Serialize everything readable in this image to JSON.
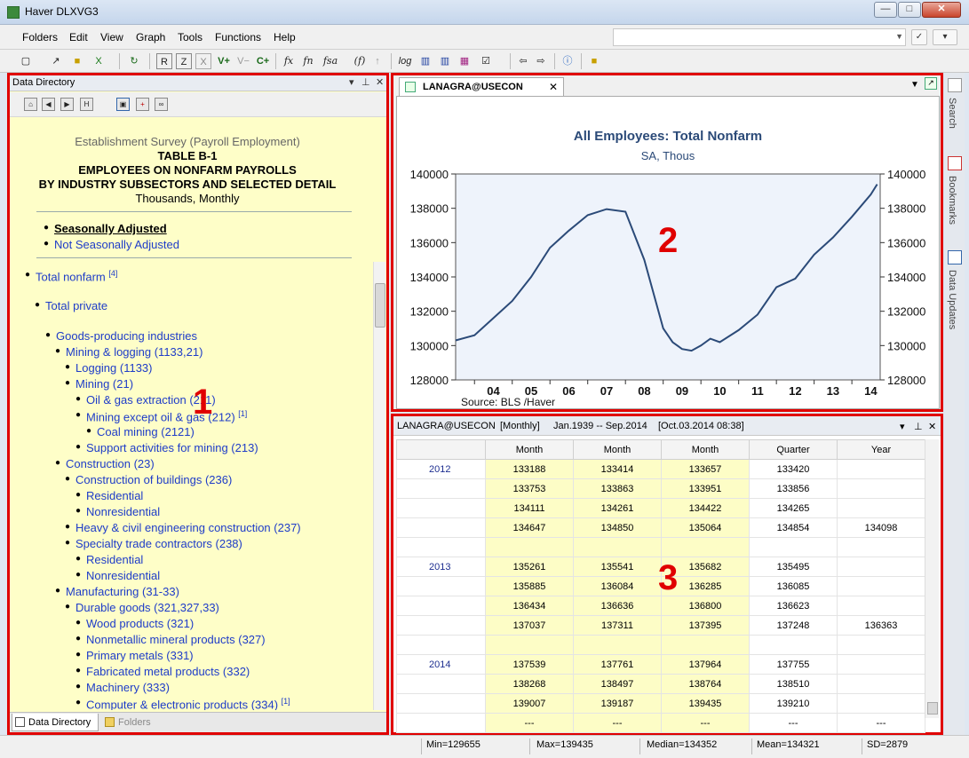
{
  "window": {
    "title": "Haver DLXVG3"
  },
  "menu": [
    "Folders",
    "Edit",
    "View",
    "Graph",
    "Tools",
    "Functions",
    "Help"
  ],
  "toolbar_labels": [
    "R",
    "Z",
    "X",
    "V+",
    "V−",
    "C+",
    "fx",
    "fn",
    "fsa",
    "(f)",
    "log"
  ],
  "data_directory": {
    "panel_title": "Data Directory",
    "heading": "Establishment Survey (Payroll Employment)",
    "table": "TABLE B-1",
    "line1": "EMPLOYEES ON NONFARM PAYROLLS",
    "line2": "BY INDUSTRY SUBSECTORS AND SELECTED DETAIL",
    "units": "Thousands, Monthly",
    "seasonal": "Seasonally Adjusted",
    "not_seasonal": "Not Seasonally Adjusted",
    "total_nonfarm": "Total nonfarm",
    "total_nonfarm_note": "[4]",
    "total_private": "Total private",
    "items": [
      {
        "text": "Goods-producing industries",
        "note": ""
      },
      {
        "text": "Mining & logging (1133,21)",
        "note": ""
      },
      {
        "text": "Logging (1133)",
        "note": ""
      },
      {
        "text": "Mining (21)",
        "note": ""
      },
      {
        "text": "Oil & gas extraction (211)",
        "note": ""
      },
      {
        "text": "Mining except oil & gas (212)",
        "note": "[1]"
      },
      {
        "text": "Coal mining (2121)",
        "note": ""
      },
      {
        "text": "Support activities for mining (213)",
        "note": ""
      },
      {
        "text": "Construction (23)",
        "note": ""
      },
      {
        "text": "Construction of buildings (236)",
        "note": ""
      },
      {
        "text": "Residential",
        "note": ""
      },
      {
        "text": "Nonresidential",
        "note": ""
      },
      {
        "text": "Heavy & civil engineering construction (237)",
        "note": ""
      },
      {
        "text": "Specialty trade contractors (238)",
        "note": ""
      },
      {
        "text": "Residential",
        "note": ""
      },
      {
        "text": "Nonresidential",
        "note": ""
      },
      {
        "text": "Manufacturing (31-33)",
        "note": ""
      },
      {
        "text": "Durable goods (321,327,33)",
        "note": ""
      },
      {
        "text": "Wood products (321)",
        "note": ""
      },
      {
        "text": "Nonmetallic mineral products (327)",
        "note": ""
      },
      {
        "text": "Primary metals (331)",
        "note": ""
      },
      {
        "text": "Fabricated metal products (332)",
        "note": ""
      },
      {
        "text": "Machinery (333)",
        "note": ""
      },
      {
        "text": "Computer & electronic products (334)",
        "note": "[1]"
      }
    ],
    "tab_directory": "Data Directory",
    "tab_folders": "Folders"
  },
  "graph": {
    "tab_label": "LANAGRA@USECON"
  },
  "table": {
    "header_series": "LANAGRA@USECON",
    "header_freq": "[Monthly]",
    "header_range": "Jan.1939 -- Sep.2014",
    "header_updated": "[Oct.03.2014 08:38]",
    "columns": [
      "",
      "Month",
      "Month",
      "Month",
      "Quarter",
      "Year"
    ],
    "rows": [
      [
        "2012",
        "133188",
        "133414",
        "133657",
        "133420",
        ""
      ],
      [
        "",
        "133753",
        "133863",
        "133951",
        "133856",
        ""
      ],
      [
        "",
        "134111",
        "134261",
        "134422",
        "134265",
        ""
      ],
      [
        "",
        "134647",
        "134850",
        "135064",
        "134854",
        "134098"
      ],
      [
        "",
        "",
        "",
        "",
        "",
        ""
      ],
      [
        "2013",
        "135261",
        "135541",
        "135682",
        "135495",
        ""
      ],
      [
        "",
        "135885",
        "136084",
        "136285",
        "136085",
        ""
      ],
      [
        "",
        "136434",
        "136636",
        "136800",
        "136623",
        ""
      ],
      [
        "",
        "137037",
        "137311",
        "137395",
        "137248",
        "136363"
      ],
      [
        "",
        "",
        "",
        "",
        "",
        ""
      ],
      [
        "2014",
        "137539",
        "137761",
        "137964",
        "137755",
        ""
      ],
      [
        "",
        "138268",
        "138497",
        "138764",
        "138510",
        ""
      ],
      [
        "",
        "139007",
        "139187",
        "139435",
        "139210",
        ""
      ],
      [
        "",
        "---",
        "---",
        "---",
        "---",
        "---"
      ]
    ]
  },
  "sidebar": {
    "search": "Search",
    "bookmarks": "Bookmarks",
    "updates": "Data Updates"
  },
  "status": {
    "min": "Min=129655",
    "max": "Max=139435",
    "median": "Median=134352",
    "mean": "Mean=134321",
    "sd": "SD=2879"
  },
  "annotations": {
    "a1": "1",
    "a2": "2",
    "a3": "3"
  },
  "chart_data": {
    "type": "line",
    "title": "All Employees: Total Nonfarm",
    "subtitle": "SA, Thous",
    "source": "Source:  BLS /Haver",
    "ylim": [
      128000,
      140000
    ],
    "yticks": [
      "128000",
      "130000",
      "132000",
      "134000",
      "136000",
      "138000",
      "140000"
    ],
    "xticks": [
      "04",
      "05",
      "06",
      "07",
      "08",
      "09",
      "10",
      "11",
      "12",
      "13",
      "14"
    ],
    "series": [
      {
        "x": [
          2003.5,
          2004,
          2004.5,
          2005,
          2005.5,
          2006,
          2006.5,
          2007,
          2007.5,
          2008,
          2008.5,
          2009,
          2009.25,
          2009.5,
          2009.75,
          2010,
          2010.25,
          2010.5,
          2011,
          2011.5,
          2012,
          2012.5,
          2013,
          2013.5,
          2014,
          2014.5,
          2014.67
        ],
        "y": [
          130300,
          130600,
          131600,
          132600,
          134000,
          135700,
          136700,
          137600,
          137950,
          137800,
          135000,
          131000,
          130200,
          129800,
          129700,
          130000,
          130400,
          130200,
          130900,
          131800,
          133400,
          133900,
          135300,
          136300,
          137500,
          138800,
          139400
        ]
      }
    ],
    "grid": false
  }
}
